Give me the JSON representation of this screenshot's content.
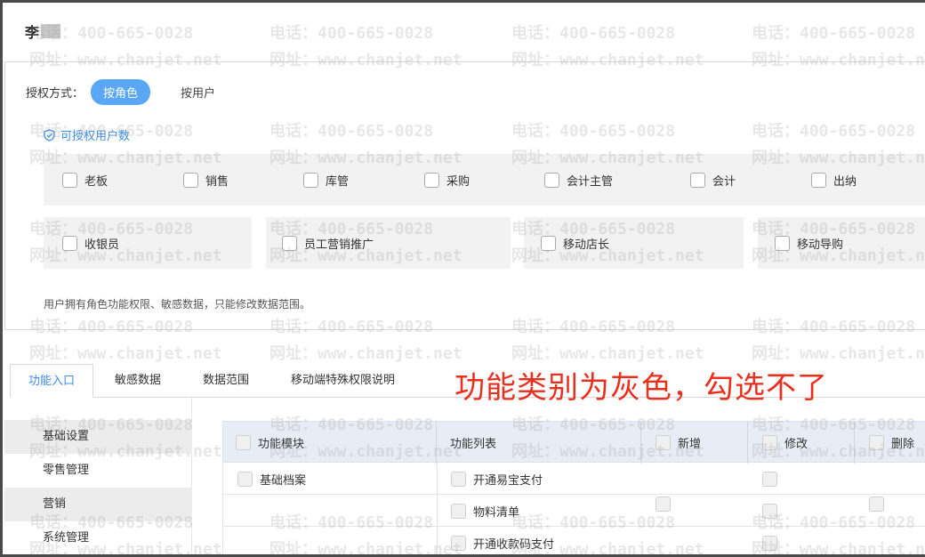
{
  "header": {
    "title": "李"
  },
  "auth": {
    "label": "授权方式：",
    "by_role": "按角色",
    "by_user": "按用户",
    "count_label": "可授权用户数"
  },
  "roles_row1": [
    "老板",
    "销售",
    "库管",
    "采购",
    "会计主管",
    "会计",
    "出纳"
  ],
  "roles_row2": [
    "收银员",
    "员工营销推广",
    "移动店长",
    "移动导购"
  ],
  "note": "用户拥有角色功能权限、敏感数据，只能修改数据范围。",
  "tabs": [
    "功能入口",
    "敏感数据",
    "数据范围",
    "移动端特殊权限说明"
  ],
  "annotation": "功能类别为灰色，勾选不了",
  "sidebar": [
    "基础设置",
    "零售管理",
    "营销",
    "系统管理"
  ],
  "table": {
    "headers": [
      "功能模块",
      "功能列表",
      "新增",
      "修改",
      "删除"
    ],
    "rows": [
      {
        "module": "基础档案",
        "func": "开通易宝支付"
      },
      {
        "module": "",
        "func": "物料清单"
      },
      {
        "module": "",
        "func": "开通收款码支付"
      }
    ]
  },
  "watermark": {
    "phone": "电话：400-665-0028",
    "site": "网址：www.chanjet.net"
  },
  "colors": {
    "accent": "#5aa7f5",
    "link": "#3c8ee8",
    "annotation": "#e8301f"
  }
}
